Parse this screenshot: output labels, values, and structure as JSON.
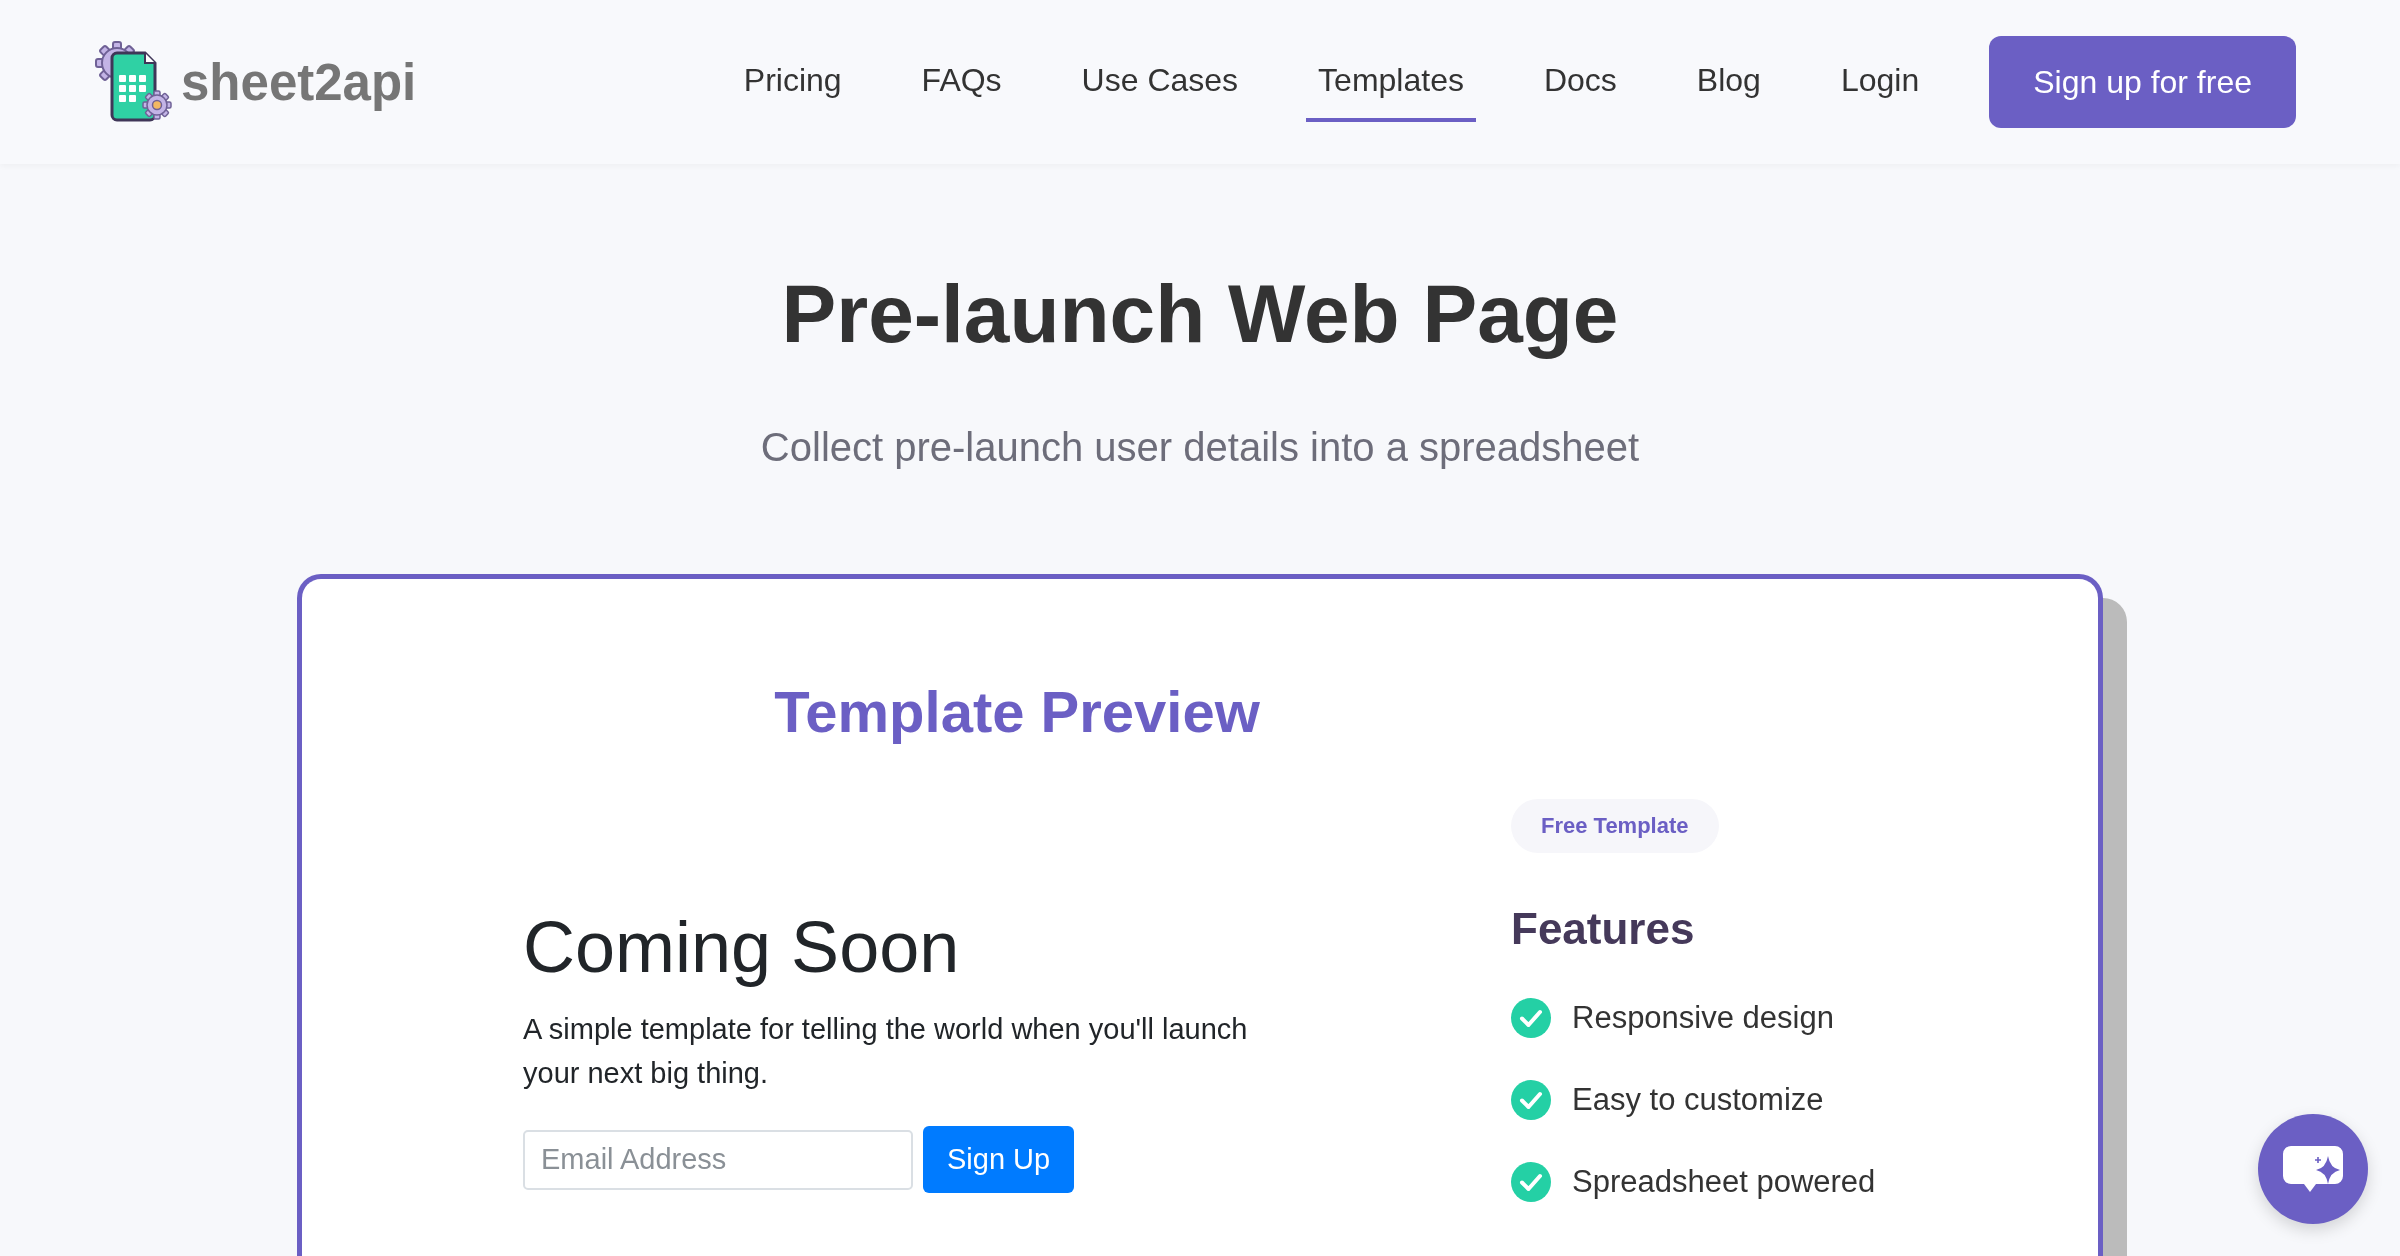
{
  "header": {
    "logo": {
      "text": "sheet2api"
    },
    "nav": [
      {
        "label": "Pricing",
        "selected": false
      },
      {
        "label": "FAQs",
        "selected": false
      },
      {
        "label": "Use Cases",
        "selected": false
      },
      {
        "label": "Templates",
        "selected": true
      },
      {
        "label": "Docs",
        "selected": false
      },
      {
        "label": "Blog",
        "selected": false
      },
      {
        "label": "Login",
        "selected": false
      }
    ],
    "cta": "Sign up for free"
  },
  "hero": {
    "title": "Pre-launch Web Page",
    "subtitle": "Collect pre-launch user details into a spreadsheet"
  },
  "preview_card": {
    "heading": "Template Preview",
    "preview": {
      "title": "Coming Soon",
      "text": "A simple template for telling the world when you'll launch your next big thing.",
      "email_field": {
        "placeholder": "Email Address"
      },
      "button": "Sign Up"
    },
    "badge": "Free Template",
    "features_title": "Features",
    "features": [
      "Responsive design",
      "Easy to customize",
      "Spreadsheet powered"
    ]
  }
}
